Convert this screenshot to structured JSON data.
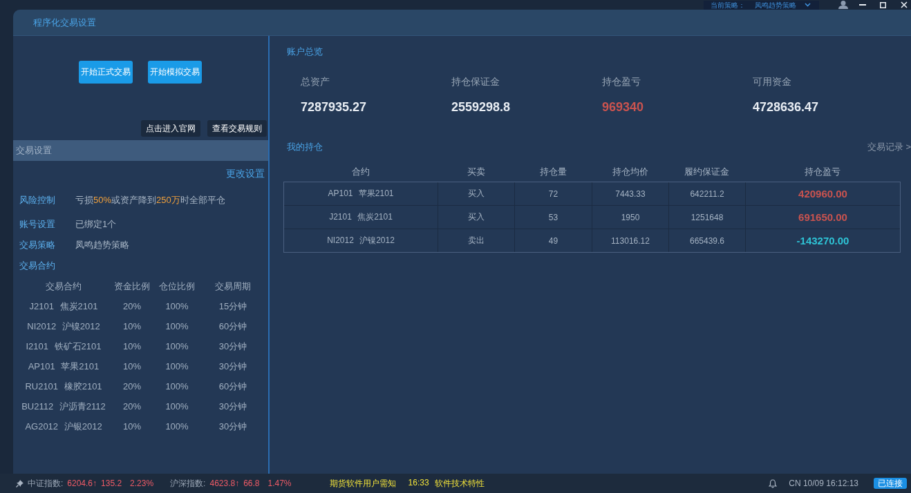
{
  "top_bar": {
    "strategy_label": "当前策略：",
    "strategy_value": "凤鸣趋势策略"
  },
  "window": {
    "title": "程序化交易设置"
  },
  "left_panel": {
    "primary_buttons": [
      "开始正式交易",
      "开始模拟交易"
    ],
    "secondary_buttons": [
      "点击进入官网",
      "查看交易规则"
    ],
    "section_title": "交易设置",
    "edit_link": "更改设置",
    "settings": [
      {
        "label": "风险控制",
        "value": "亏损**50%**或资产降到**250万**时全部平仓"
      },
      {
        "label": "账号设置",
        "value": "已绑定1个"
      },
      {
        "label": "交易策略",
        "value": "凤鸣趋势策略"
      }
    ],
    "contracts": {
      "title": "交易合约",
      "columns": [
        "交易合约",
        "资金比例",
        "仓位比例",
        "交易周期"
      ],
      "rows": [
        [
          "J2101 焦炭2101",
          "20%",
          "100%",
          "15分钟"
        ],
        [
          "NI2012 沪镍2012",
          "10%",
          "100%",
          "60分钟"
        ],
        [
          "I2101 铁矿石2101",
          "10%",
          "100%",
          "30分钟"
        ],
        [
          "AP101 苹果2101",
          "10%",
          "100%",
          "30分钟"
        ],
        [
          "RU2101 橡胶2101",
          "20%",
          "100%",
          "60分钟"
        ],
        [
          "BU2112 沪沥青2112",
          "20%",
          "100%",
          "30分钟"
        ],
        [
          "AG2012 沪银2012",
          "10%",
          "100%",
          "30分钟"
        ]
      ]
    }
  },
  "account_overview": {
    "title": "账户总览",
    "stats": [
      {
        "label": "总资产",
        "value": "7287935.27",
        "color": "#e8edf3"
      },
      {
        "label": "持仓保证金",
        "value": "2559298.8",
        "color": "#e8edf3"
      },
      {
        "label": "持仓盈亏",
        "value": "969340",
        "color": "#c9534f"
      },
      {
        "label": "可用资金",
        "value": "4728636.47",
        "color": "#e8edf3"
      }
    ]
  },
  "positions": {
    "title": "我的持仓",
    "history_link": "交易记录 >",
    "columns": [
      "合约",
      "买卖",
      "持仓量",
      "持仓均价",
      "履约保证金",
      "持仓盈亏"
    ],
    "rows": [
      {
        "cells": [
          "AP101 苹果2101",
          "买入",
          "72",
          "7443.33",
          "642211.2"
        ],
        "pnl": "420960.00",
        "color": "#c9534f"
      },
      {
        "cells": [
          "J2101 焦炭2101",
          "买入",
          "53",
          "1950",
          "1251648"
        ],
        "pnl": "691650.00",
        "color": "#c9534f"
      },
      {
        "cells": [
          "NI2012 沪镍2012",
          "卖出",
          "49",
          "113016.12",
          "665439.6"
        ],
        "pnl": "-143270.00",
        "color": "#2ec4d6"
      }
    ]
  },
  "status_bar": {
    "indices": [
      {
        "name": "中证指数:",
        "price": "6204.6↑",
        "change": "135.2",
        "percent": "2.23%",
        "rising": true
      },
      {
        "name": "沪深指数:",
        "price": "4623.8↑",
        "change": "66.8",
        "percent": "1.47%",
        "rising": true
      }
    ],
    "ticker": [
      {
        "text": "期货软件用户需知"
      },
      {
        "time": "16:33",
        "text": "软件技术特性"
      }
    ],
    "clock": "CN 10/09 16:12:13",
    "connection": "已连接"
  }
}
